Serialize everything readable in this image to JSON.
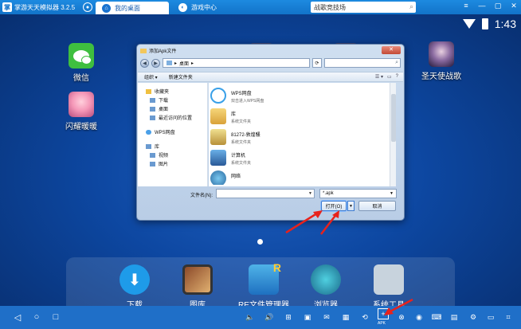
{
  "app": {
    "title": "掌游天天模拟器 3.2.5",
    "logo_text": "掌"
  },
  "tabs": [
    {
      "label": "我的桌面",
      "icon": "home-icon"
    },
    {
      "label": "游戏中心",
      "icon": "game-center-icon"
    }
  ],
  "search": {
    "value": "战歌竞技场"
  },
  "window_controls": [
    "menu-icon",
    "minimize-icon",
    "maximize-icon",
    "close-icon"
  ],
  "status": {
    "time": "1:43"
  },
  "desktop_icons": [
    {
      "label": "微信",
      "icon": "wechat-icon"
    },
    {
      "label": "闪耀暖暖",
      "icon": "shining-nikki-icon"
    },
    {
      "label": "圣天使战歌",
      "icon": "angel-war-song-icon"
    }
  ],
  "dock": [
    {
      "label": "下载",
      "icon": "download-icon",
      "glyph": "⬇"
    },
    {
      "label": "图库",
      "icon": "gallery-icon"
    },
    {
      "label": "RE文件管理器",
      "icon": "re-file-manager-icon"
    },
    {
      "label": "浏览器",
      "icon": "browser-icon"
    },
    {
      "label": "系统工具",
      "icon": "system-tools-icon"
    }
  ],
  "dialog": {
    "title": "添加Apk文件",
    "close_glyph": "✕",
    "breadcrumb": "桌面",
    "breadcrumb_sep": "▸",
    "back_glyph": "◀",
    "forward_glyph": "▶",
    "refresh_glyph": "⟳",
    "search_glyph": "⌕",
    "commands": [
      "组织 ▾",
      "新建文件夹"
    ],
    "view_glyphs": [
      "☰ ▾",
      "▭",
      "?"
    ],
    "nav_pane": [
      {
        "label": "收藏夹",
        "icon": "favorites-icon",
        "sub": false
      },
      {
        "label": "下载",
        "icon": "downloads-folder-icon",
        "sub": true
      },
      {
        "label": "桌面",
        "icon": "desktop-folder-icon",
        "sub": true
      },
      {
        "label": "最近访问的位置",
        "icon": "recent-places-icon",
        "sub": true
      },
      {
        "label": "WPS网盘",
        "icon": "wps-cloud-icon",
        "sub": false
      },
      {
        "label": "库",
        "icon": "libraries-icon",
        "sub": false
      },
      {
        "label": "视频",
        "icon": "videos-icon",
        "sub": true
      },
      {
        "label": "图片",
        "icon": "pictures-icon",
        "sub": true
      }
    ],
    "files": [
      {
        "name": "WPS网盘",
        "desc": "双击进入WPS网盘",
        "icon": "wps-cloud-icon"
      },
      {
        "name": "库",
        "desc": "系统文件夹",
        "icon": "library-icon"
      },
      {
        "name": "81272-敦煌騷",
        "desc": "系统文件夹",
        "icon": "user-folder-icon"
      },
      {
        "name": "计算机",
        "desc": "系统文件夹",
        "icon": "computer-icon"
      },
      {
        "name": "网络",
        "desc": "",
        "icon": "network-icon"
      }
    ],
    "filename_label": "文件名(N):",
    "filename_value": "",
    "filetype": "*.apk",
    "open_label": "打开(O)",
    "cancel_label": "取消"
  },
  "toolbar": {
    "nav": [
      "◁",
      "○",
      "□"
    ],
    "tools": [
      "🔈",
      "🔊",
      "⊞",
      "▣",
      "✉",
      "▦",
      "⟲",
      "🗑",
      "+",
      "⊗",
      "◉",
      "⌨",
      "▤",
      "⚙",
      "▭",
      "⌗"
    ],
    "tool_names": [
      "volume-down-icon",
      "volume-up-icon",
      "fullscreen-icon",
      "screenshot-icon",
      "message-icon",
      "multi-window-icon",
      "rotate-icon",
      "clean-icon",
      "add-apk-icon",
      "gps-icon",
      "record-icon",
      "keyboard-icon",
      "file-share-icon",
      "settings-icon",
      "window-icon",
      "more-icon"
    ],
    "addapk_label": "APK"
  },
  "colors": {
    "accent": "#1f6fc8",
    "desktop": "#0d47a1",
    "arrow": "#e8221c"
  }
}
